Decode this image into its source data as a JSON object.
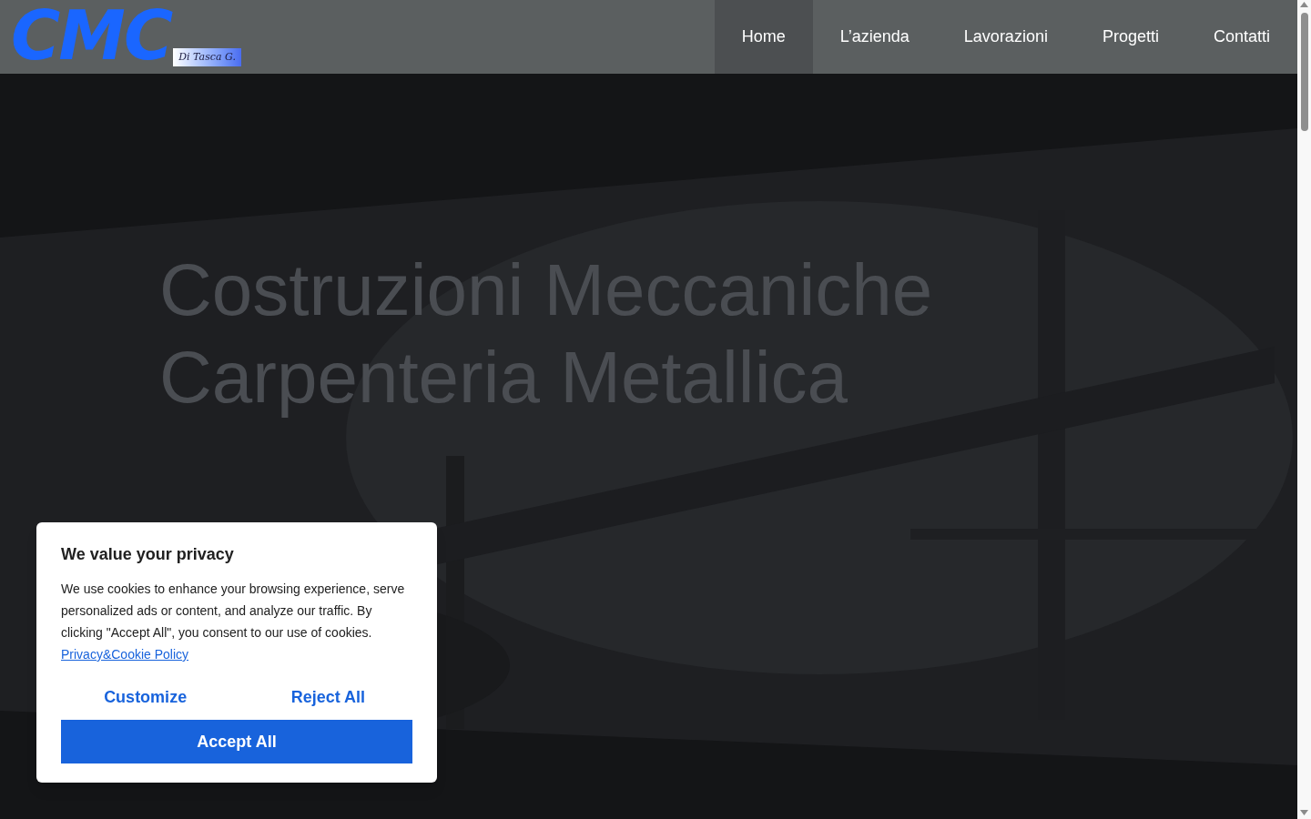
{
  "logo": {
    "mark": "CMC",
    "tagline": "Di Tasca G."
  },
  "nav": [
    {
      "label": "Home",
      "selected": true
    },
    {
      "label": "L’azienda",
      "selected": false
    },
    {
      "label": "Lavorazioni",
      "selected": false
    },
    {
      "label": "Progetti",
      "selected": false
    },
    {
      "label": "Contatti",
      "selected": false
    }
  ],
  "hero": {
    "title_lines": [
      "Costruzioni Meccaniche",
      "Carpenteria Metallica"
    ]
  },
  "cookie_banner": {
    "title": "We value your privacy",
    "text": "We use cookies to enhance your browsing experience, serve personalized ads or content, and analyze our traffic. By clicking \"Accept All\", you consent to our use of cookies.",
    "link": "Privacy&Cookie Policy",
    "buttons": [
      {
        "label": "Customize",
        "kind": "text"
      },
      {
        "label": "Reject All",
        "kind": "text"
      },
      {
        "label": "Accept All",
        "kind": "primary"
      }
    ]
  }
}
